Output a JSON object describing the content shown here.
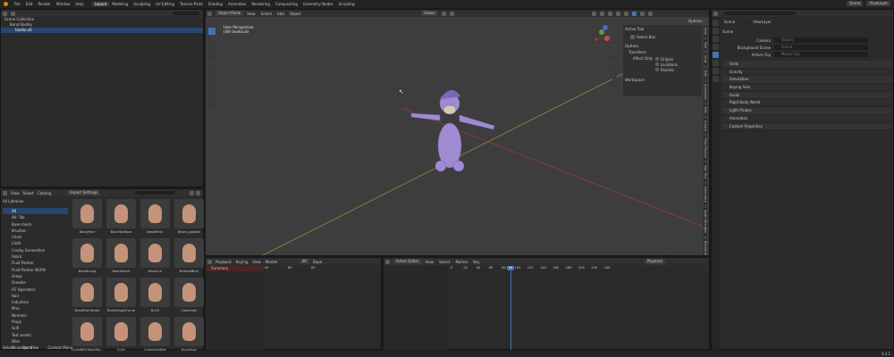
{
  "topbar": {
    "menu": [
      "File",
      "Edit",
      "Render",
      "Window",
      "Help"
    ],
    "workspaces": [
      "Layout",
      "Modeling",
      "Sculpting",
      "UV Editing",
      "Texture Paint",
      "Shading",
      "Animation",
      "Rendering",
      "Compositing",
      "Geometry Nodes",
      "Scripting"
    ],
    "active_workspace": "Layout",
    "scene_label": "Scene",
    "viewlayer_label": "ViewLayer"
  },
  "outliner": {
    "items": [
      {
        "label": "Scene Collection",
        "selected": false
      },
      {
        "label": "Bonzi Buddy",
        "selected": false
      },
      {
        "label": "Useful.stl",
        "selected": true
      }
    ]
  },
  "asset_browser": {
    "header": {
      "view": "View",
      "select": "Select",
      "catalog": "Catalog",
      "import": "Import Settings"
    },
    "library": "All Libraries",
    "categories": [
      {
        "label": "All",
        "selected": true
      },
      {
        "label": "4K: Tab",
        "selected": false
      },
      {
        "label": "Base mesh",
        "selected": false
      },
      {
        "label": "Brushes",
        "selected": false
      },
      {
        "label": "Chain",
        "selected": false
      },
      {
        "label": "Cloth",
        "selected": false
      },
      {
        "label": "Crocky Generative",
        "selected": false
      },
      {
        "label": "Fabric",
        "selected": false
      },
      {
        "label": "Fluid Painter",
        "selected": false
      },
      {
        "label": "Fluid Painter NSFW",
        "selected": false
      },
      {
        "label": "Grasp",
        "selected": false
      },
      {
        "label": "Greeble",
        "selected": false
      },
      {
        "label": "HT Operators",
        "selected": false
      },
      {
        "label": "Hair",
        "selected": false
      },
      {
        "label": "Industrial",
        "selected": false
      },
      {
        "label": "Misc",
        "selected": false
      },
      {
        "label": "Normals",
        "selected": false
      },
      {
        "label": "Props",
        "selected": false
      },
      {
        "label": "Scifi",
        "selected": false
      },
      {
        "label": "Test assets",
        "selected": false
      },
      {
        "label": "Wire",
        "selected": false
      },
      {
        "label": "Unassigned",
        "selected": false
      }
    ],
    "assets": [
      "BaldyHair",
      "BackToeBase",
      "BaseMesh",
      "Beard_goatee",
      "BeardLong",
      "BeardShort",
      "BowlCut",
      "BraidedBun",
      "BraidFromScalp",
      "BraidSingleCurve",
      "Bun3",
      "Cabochon",
      "CurlsWithTrackMa...",
      "Curly",
      "CurtainedHair",
      "Donutbun"
    ],
    "status": [
      "Select",
      "Pan View",
      "Context Menu"
    ]
  },
  "viewport": {
    "mode": "Object Mode",
    "menus": [
      "View",
      "Select",
      "Add",
      "Object"
    ],
    "transform": "Global",
    "overlay_text": [
      "User Perspective",
      "(49) Useful.stl"
    ],
    "options_label": "Options",
    "npanel": {
      "active_tool_title": "Active Tool",
      "active_tool": "Select Box",
      "options_title": "Options",
      "transform_title": "Transform",
      "affect_only_label": "Affect Only",
      "affect_only": [
        "Origins",
        "Locations",
        "Parents"
      ],
      "workspace_title": "Workspace"
    },
    "side_tabs": [
      "Item",
      "Tool",
      "View",
      "Edit",
      "Animation",
      "Edit",
      "Create",
      "Fluid Painter",
      "Hair Tool",
      "Geometry",
      "Node Wrangler",
      "BlenderKit"
    ]
  },
  "properties": {
    "scene_label": "Scene",
    "viewlayer_label": "ViewLayer",
    "section": "Scene",
    "fields": [
      {
        "label": "Camera",
        "placeholder": "Object"
      },
      {
        "label": "Background Scene",
        "placeholder": "Scene"
      },
      {
        "label": "Active Clip",
        "placeholder": "Movie Clip"
      }
    ],
    "panels": [
      "Units",
      "Gravity",
      "Simulation",
      "Keying Sets",
      "Audio",
      "Rigid Body World",
      "Light Probes",
      "Animation",
      "Custom Properties"
    ]
  },
  "dopesheet": {
    "menus": [
      "Playback",
      "Keying",
      "View",
      "Marker"
    ],
    "summary": "Summary",
    "ticks": [
      "40",
      "60",
      "80"
    ],
    "frame": "49",
    "dope_label": "Dope"
  },
  "action_editor": {
    "mode": "Action Editor",
    "menus": [
      "View",
      "Select",
      "Marker",
      "Key"
    ],
    "playback": "Playback",
    "ticks": [
      "0",
      "20",
      "40",
      "60",
      "80",
      "100",
      "120",
      "140",
      "160",
      "180",
      "200",
      "220",
      "240"
    ],
    "current_frame": "49"
  },
  "version": "3.4.1"
}
